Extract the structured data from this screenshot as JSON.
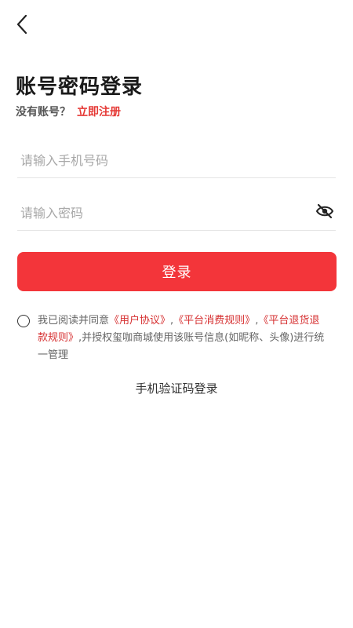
{
  "nav": {
    "back_icon": "chevron-left-icon"
  },
  "page": {
    "title": "账号密码登录",
    "no_account_prompt": "没有账号？",
    "register_link": "立即注册"
  },
  "form": {
    "phone_placeholder": "请输入手机号码",
    "phone_value": "",
    "password_placeholder": "请输入密码",
    "password_value": "",
    "eye_icon": "eye-hidden-icon",
    "login_label": "登录"
  },
  "agreement": {
    "checked": false,
    "prefix": "我已阅读并同意",
    "link_user_agreement": "《用户协议》",
    "sep1": ",",
    "link_consumption_rules": "《平台消费规则》",
    "sep2": ",",
    "link_refund_rules": "《平台退货退款规则》",
    "suffix": ",并授权玺咖商城使用该账号信息(如昵称、头像)进行统一管理"
  },
  "alt_login": {
    "sms_label": "手机验证码登录"
  },
  "colors": {
    "accent": "#f3353a",
    "link": "#d63031"
  }
}
